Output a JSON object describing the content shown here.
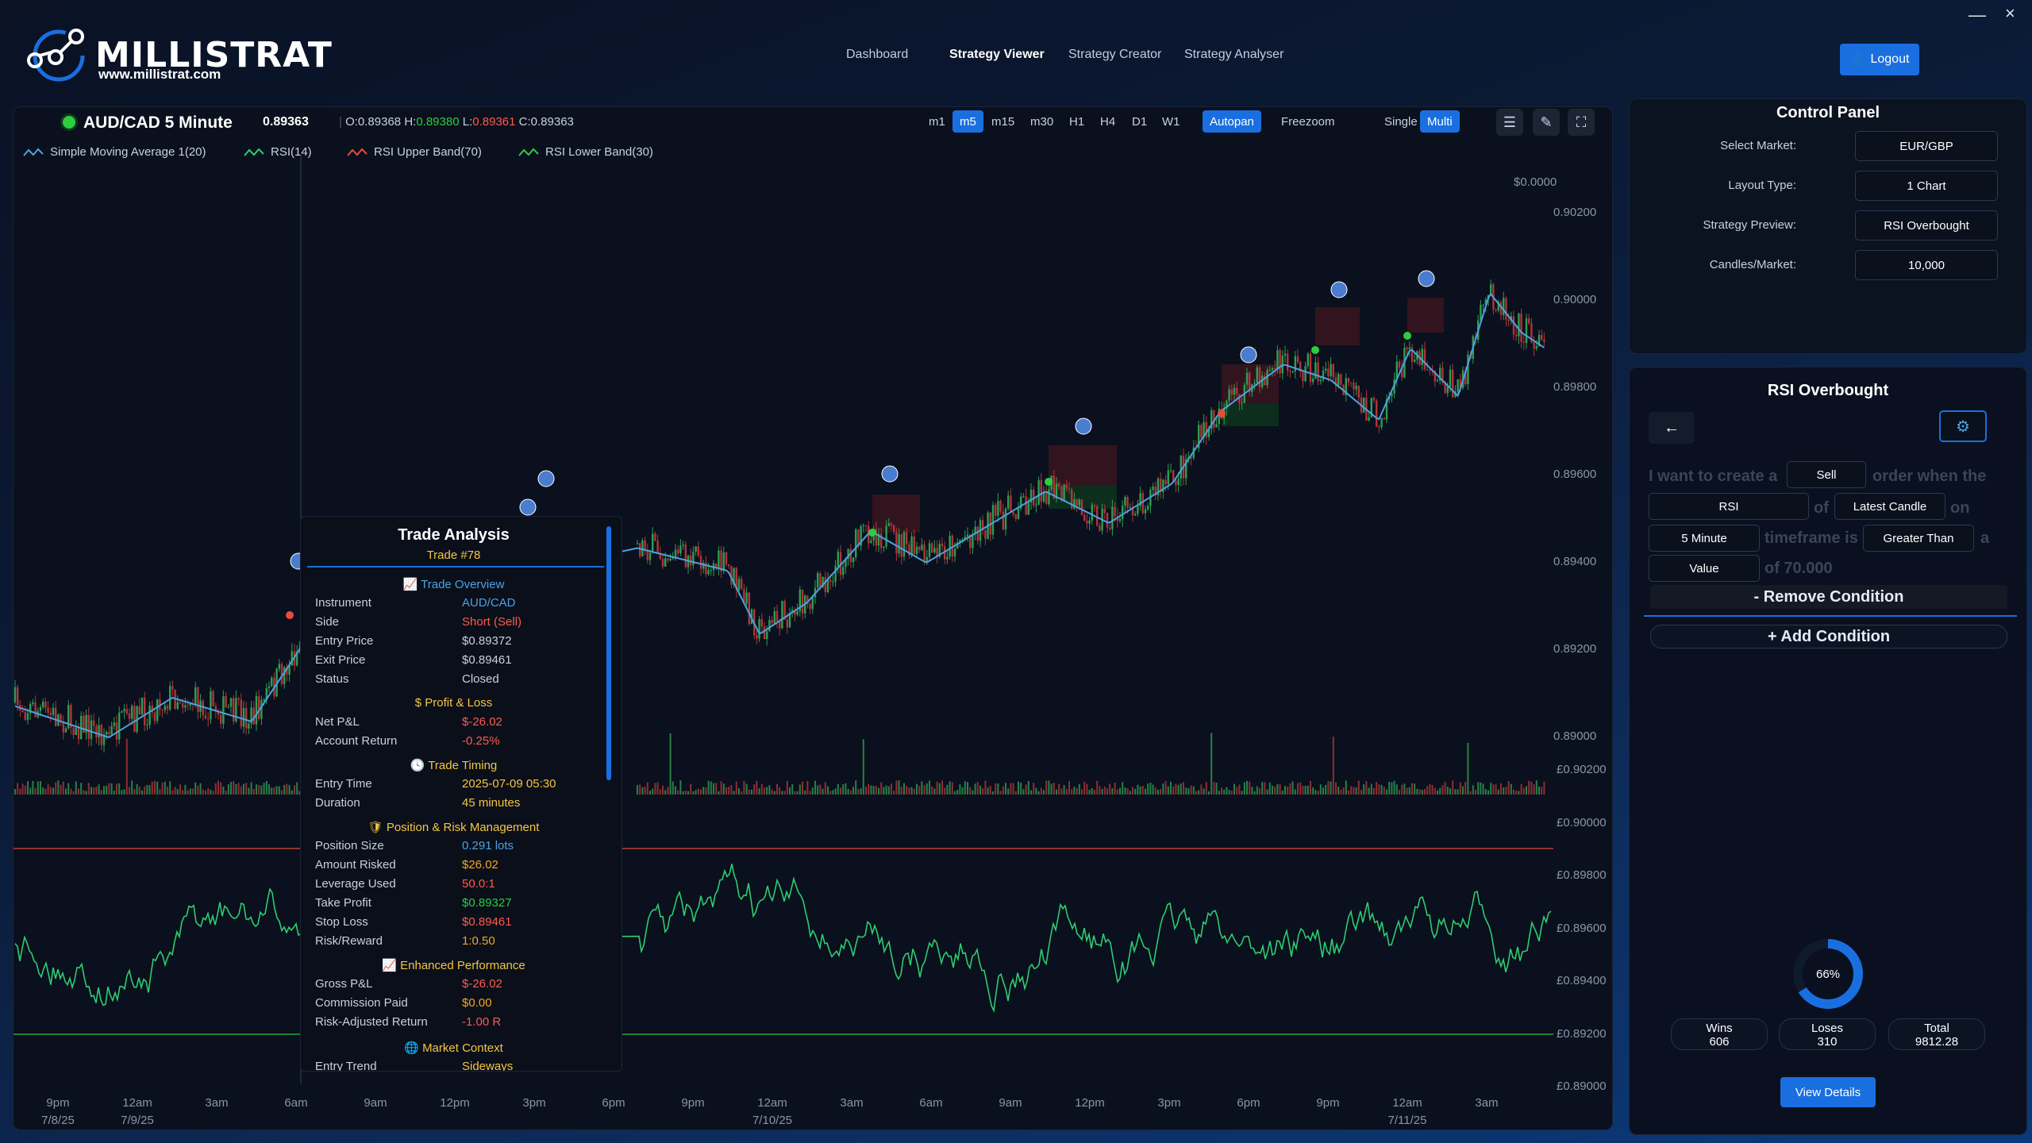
{
  "app": {
    "brand": "MILLISTRAT",
    "url": "www.millistrat.com"
  },
  "nav": [
    {
      "label": "Dashboard",
      "active": false
    },
    {
      "label": "Strategy Viewer",
      "active": true
    },
    {
      "label": "Strategy Creator",
      "active": false
    },
    {
      "label": "Strategy Analyser",
      "active": false
    }
  ],
  "header": {
    "logout_label": "Logout",
    "minimize_icon": "minimize-icon",
    "close_icon": "close-icon"
  },
  "chart": {
    "symbol": "AUD/CAD 5 Minute",
    "last_price": "0.89363",
    "ohlc": {
      "o_label": "O:",
      "o": "0.89368",
      "h_label": "H:",
      "h": "0.89380",
      "l_label": "L:",
      "l": "0.89361",
      "c_label": "C:",
      "c": "0.89363"
    },
    "timeframes": [
      {
        "label": "m1",
        "active": false
      },
      {
        "label": "m5",
        "active": true
      },
      {
        "label": "m15",
        "active": false
      },
      {
        "label": "m30",
        "active": false
      },
      {
        "label": "H1",
        "active": false
      },
      {
        "label": "H4",
        "active": false
      },
      {
        "label": "D1",
        "active": false
      },
      {
        "label": "W1",
        "active": false
      }
    ],
    "pan_modes": [
      {
        "label": "Autopan",
        "active": true
      },
      {
        "label": "Freezoom",
        "active": false
      }
    ],
    "layout_modes": [
      {
        "label": "Single",
        "active": false
      },
      {
        "label": "Multi",
        "active": true
      }
    ],
    "tools": [
      "sliders-icon",
      "pencil-icon",
      "fullscreen-icon"
    ],
    "legend": [
      {
        "label": "Simple Moving Average 1(20)",
        "color": "#4ba3e3"
      },
      {
        "label": "RSI(14)",
        "color": "#2ecc71"
      },
      {
        "label": "RSI Upper Band(70)",
        "color": "#e74c3c"
      },
      {
        "label": "RSI Lower Band(30)",
        "color": "#2ecc40"
      }
    ],
    "price_axis": [
      "$0.0000",
      "0.90200",
      "0.90000",
      "0.89800",
      "0.89600",
      "0.89400",
      "0.89200",
      "0.89000"
    ],
    "rsi_axis": [
      "£0.90200",
      "£0.90000",
      "£0.89800",
      "£0.89600",
      "£0.89400",
      "£0.89200",
      "£0.89000"
    ],
    "time_axis": [
      {
        "t": "9pm",
        "d": "7/8/25"
      },
      {
        "t": "12am",
        "d": "7/9/25"
      },
      {
        "t": "3am",
        "d": ""
      },
      {
        "t": "6am",
        "d": ""
      },
      {
        "t": "9am",
        "d": ""
      },
      {
        "t": "12pm",
        "d": ""
      },
      {
        "t": "3pm",
        "d": ""
      },
      {
        "t": "6pm",
        "d": ""
      },
      {
        "t": "9pm",
        "d": ""
      },
      {
        "t": "12am",
        "d": "7/10/25"
      },
      {
        "t": "3am",
        "d": ""
      },
      {
        "t": "6am",
        "d": ""
      },
      {
        "t": "9am",
        "d": ""
      },
      {
        "t": "12pm",
        "d": ""
      },
      {
        "t": "3pm",
        "d": ""
      },
      {
        "t": "6pm",
        "d": ""
      },
      {
        "t": "9pm",
        "d": ""
      },
      {
        "t": "12am",
        "d": "7/11/25"
      },
      {
        "t": "3am",
        "d": ""
      }
    ]
  },
  "trade": {
    "title": "Trade Analysis",
    "subtitle": "Trade #78",
    "overview_title": "Trade Overview",
    "overview": [
      {
        "k": "Instrument",
        "v": "AUD/CAD",
        "color": "#4ba3e3"
      },
      {
        "k": "Side",
        "v": "Short (Sell)",
        "color": "#ff5a4f"
      },
      {
        "k": "Entry Price",
        "v": "$0.89372",
        "color": "#c9d1dc"
      },
      {
        "k": "Exit Price",
        "v": "$0.89461",
        "color": "#c9d1dc"
      },
      {
        "k": "Status",
        "v": "Closed",
        "color": "#c9d1dc"
      }
    ],
    "pl_title": "$ Profit & Loss",
    "pl": [
      {
        "k": "Net P&L",
        "v": "$-26.02",
        "color": "#ff5a4f"
      },
      {
        "k": "Account Return",
        "v": "-0.25%",
        "color": "#ff5a4f"
      }
    ],
    "timing_title": "Trade Timing",
    "timing": [
      {
        "k": "Entry Time",
        "v": "2025-07-09 05:30",
        "color": "#f5c542"
      },
      {
        "k": "Duration",
        "v": "45 minutes",
        "color": "#f5c542"
      }
    ],
    "risk_title": "Position & Risk Management",
    "risk": [
      {
        "k": "Position Size",
        "v": "0.291 lots",
        "color": "#4ba3e3"
      },
      {
        "k": "Amount Risked",
        "v": "$26.02",
        "color": "#f5a623"
      },
      {
        "k": "Leverage Used",
        "v": "50.0:1",
        "color": "#ff5a4f"
      },
      {
        "k": "Take Profit",
        "v": "$0.89327",
        "color": "#2ecc40"
      },
      {
        "k": "Stop Loss",
        "v": "$0.89461",
        "color": "#ff5a4f"
      },
      {
        "k": "Risk/Reward",
        "v": "1:0.50",
        "color": "#f5a623"
      }
    ],
    "perf_title": "Enhanced Performance",
    "perf": [
      {
        "k": "Gross P&L",
        "v": "$-26.02",
        "color": "#ff5a4f"
      },
      {
        "k": "Commission Paid",
        "v": "$0.00",
        "color": "#f5a623"
      },
      {
        "k": "Risk-Adjusted Return",
        "v": "-1.00 R",
        "color": "#ff5a4f"
      }
    ],
    "market_title": "Market Context",
    "market_row": {
      "k": "Entry Trend",
      "v": "Sideways"
    }
  },
  "control": {
    "title": "Control Panel",
    "fields": [
      {
        "label": "Select Market:",
        "value": "EUR/GBP"
      },
      {
        "label": "Layout Type:",
        "value": "1 Chart"
      },
      {
        "label": "Strategy Preview:",
        "value": "RSI Overbought"
      },
      {
        "label": "Candles/Market:",
        "value": "10,000"
      }
    ]
  },
  "strategy": {
    "title": "RSI Overbought",
    "sentence": {
      "t1": "I want to create a",
      "order": "Sell",
      "t2": "order when the",
      "indicator": "RSI",
      "t3": "of",
      "candle": "Latest Candle",
      "t4": "on",
      "timeframe": "5 Minute",
      "t5": "timeframe is",
      "comparator": "Greater Than",
      "t6": "a",
      "type": "Value",
      "t7": "of 70.000"
    },
    "remove_label": "- Remove Condition",
    "add_label": "+ Add Condition",
    "win_rate": 66,
    "win_rate_label": "66%",
    "stats": [
      {
        "label": "Wins",
        "value": "606"
      },
      {
        "label": "Loses",
        "value": "310"
      },
      {
        "label": "Total",
        "value": "9812.28"
      }
    ],
    "view_details_label": "View Details"
  }
}
